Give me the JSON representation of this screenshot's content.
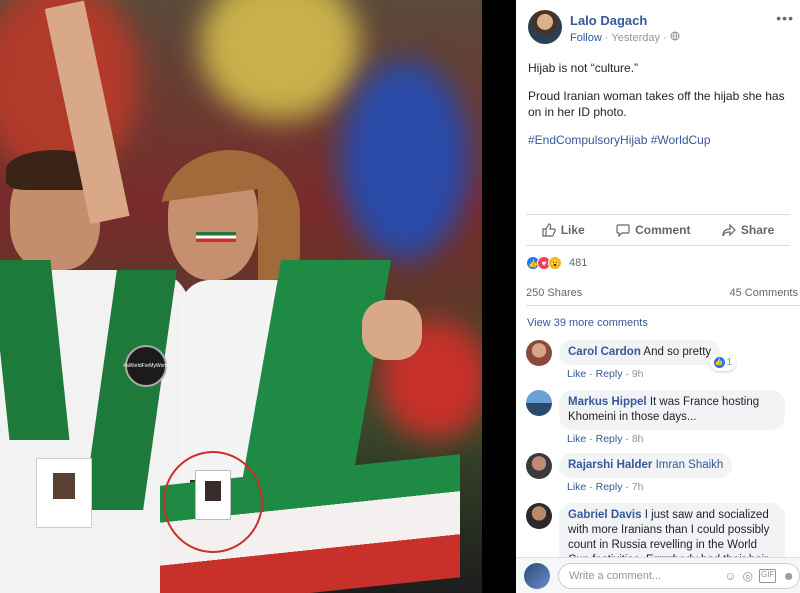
{
  "post": {
    "author": "Lalo Dagach",
    "follow": "Follow",
    "time": "Yesterday",
    "more": "•••",
    "line1": "Hijab is not “culture.”",
    "line2": "Proud Iranian woman takes off the hijab she has on in her ID photo.",
    "hashtags": "#EndCompulsoryHijab #WorldCup"
  },
  "actions": {
    "like": "Like",
    "comment": "Comment",
    "share": "Share"
  },
  "stats": {
    "reactions": "481",
    "shares": "250 Shares",
    "comments": "45 Comments"
  },
  "view_more": "View 39 more comments",
  "comments": [
    {
      "name": "Carol Cardon",
      "text": "And so pretty",
      "like": "Like",
      "reply": "Reply",
      "time": "9h",
      "likes": "1"
    },
    {
      "name": "Markus Hippel",
      "text": "It was France hosting Khomeini in those days...",
      "like": "Like",
      "reply": "Reply",
      "time": "8h"
    },
    {
      "name": "Rajarshi Halder",
      "mention": "Imran Shaikh",
      "like": "Like",
      "reply": "Reply",
      "time": "7h"
    },
    {
      "name": "Gabriel Davis",
      "text": "I just saw and socialized with more Iranians than I could possibly count in Russia revelling in the World Cup festivities. Errrrrbody had their hair"
    }
  ],
  "composer": {
    "placeholder": "Write a comment..."
  },
  "photo": {
    "badge_text": "#aWorldForMyWorld"
  },
  "colors": {
    "link": "#365899",
    "like_blue": "#1877f2",
    "love_red": "#f33e58",
    "wow_yellow": "#f7b125"
  }
}
